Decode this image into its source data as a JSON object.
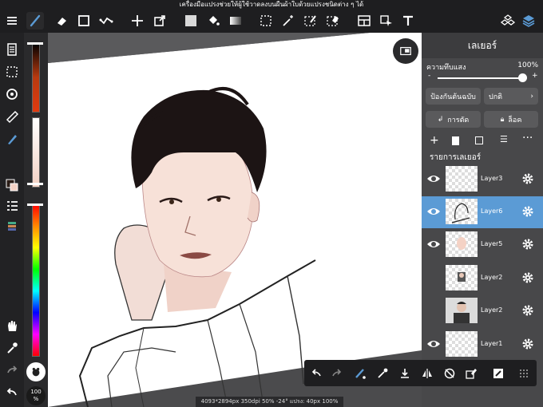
{
  "tip": "เครื่องมือแปรงช่วยให้ผู้ใช้วาดลงบนผืนผ้าใบด้วยแปรงชนิดต่าง ๆ ได้",
  "toolbar": {
    "menu_icon": "menu-icon",
    "brush_icon": "brush-icon",
    "eraser_icon": "eraser-icon",
    "rect_icon": "rect-icon",
    "transform_icon": "transform-icon",
    "move_icon": "move-icon",
    "export_icon": "export-icon",
    "fill_icon": "fill-icon",
    "bucket_icon": "bucket-icon",
    "gradient_icon": "gradient-icon",
    "select_icon": "select-icon",
    "wand_icon": "magic-wand-icon",
    "pen_select_icon": "pen-select-icon",
    "erase_select_icon": "erase-select-icon",
    "frame_icon": "frame-icon",
    "pointer_icon": "pointer-icon",
    "text_icon": "text-icon",
    "materials_icon": "materials-icon",
    "layers_icon": "layers-icon"
  },
  "left_tools": {
    "percent": "100",
    "percent_unit": "%"
  },
  "panel": {
    "title": "เลเยอร์",
    "opacity_label": "ความทึบแสง",
    "opacity_value": "100%",
    "opacity": 1.0,
    "protect_label": "ป้องกันต้นฉบับ",
    "blend_label": "ปกติ",
    "clip_label": "การตัด",
    "lock_label": "ล็อค",
    "list_title": "รายการเลเยอร์",
    "layers": [
      {
        "name": "Layer3"
      },
      {
        "name": "Layer6"
      },
      {
        "name": "Layer5"
      },
      {
        "name": "Layer2"
      },
      {
        "name": "Layer2"
      },
      {
        "name": "Layer1"
      }
    ]
  },
  "status": "4093*2894px 350dpi 50% -24° แปรง: 40px 100%",
  "colors": {
    "accent": "#5b9bd5",
    "topbar": "#1e1e20",
    "panel": "#48484a"
  }
}
